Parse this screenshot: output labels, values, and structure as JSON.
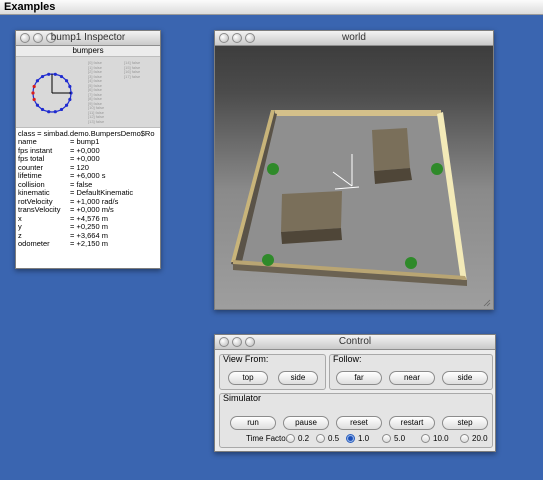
{
  "app": {
    "title": "Examples"
  },
  "inspector": {
    "title": "bump1 Inspector",
    "sensor_title": "bumpers",
    "sensor_entries_col1": [
      "[0] false",
      "[1] false",
      "[2] false",
      "[3] false",
      "[4] false",
      "[5] false",
      "[6] false",
      "[7] false",
      "[8] false",
      "[9] false",
      "[10] false",
      "[11] false",
      "[12] false",
      "[13] false"
    ],
    "sensor_entries_col2": [
      "[14] false",
      "[15] false",
      "[16] false",
      "[17] false"
    ],
    "class_line": "class = simbad.demo.BumpersDemo$Ro",
    "rows": [
      {
        "key": "name",
        "value": "= bump1"
      },
      {
        "key": "fps instant",
        "value": "= +0,000"
      },
      {
        "key": "fps total",
        "value": "= +0,000"
      },
      {
        "key": "counter",
        "value": "= 120"
      },
      {
        "key": "lifetime",
        "value": "= +6,000 s"
      },
      {
        "key": "collision",
        "value": "= false"
      },
      {
        "key": "kinematic",
        "value": "= DefaultKinematic"
      },
      {
        "key": "rotVelocity",
        "value": "= +1,000 rad/s"
      },
      {
        "key": "transVelocity",
        "value": "= +0,000 m/s"
      },
      {
        "key": "x",
        "value": "= +4,576 m"
      },
      {
        "key": "y",
        "value": "= +0,250 m"
      },
      {
        "key": "z",
        "value": "= +3,664 m"
      },
      {
        "key": "odometer",
        "value": "= +2,150 m"
      }
    ]
  },
  "world": {
    "title": "world"
  },
  "control": {
    "title": "Control",
    "view_from": {
      "label": "View From:",
      "buttons": [
        "top",
        "side"
      ]
    },
    "follow": {
      "label": "Follow:",
      "buttons": [
        "far",
        "near",
        "side"
      ]
    },
    "simulator": {
      "label": "Simulator",
      "buttons": [
        "run",
        "pause",
        "reset",
        "restart",
        "step"
      ]
    },
    "time_factor": {
      "label": "Time Factor",
      "options": [
        "0.2",
        "0.5",
        "1.0",
        "5.0",
        "10.0",
        "20.0"
      ],
      "selected": "1.0"
    }
  },
  "colors": {
    "desktop": "#3a65b0",
    "wall_top": "#d8c48a",
    "box": "#6e6350",
    "robot": "#2f8a2a"
  }
}
